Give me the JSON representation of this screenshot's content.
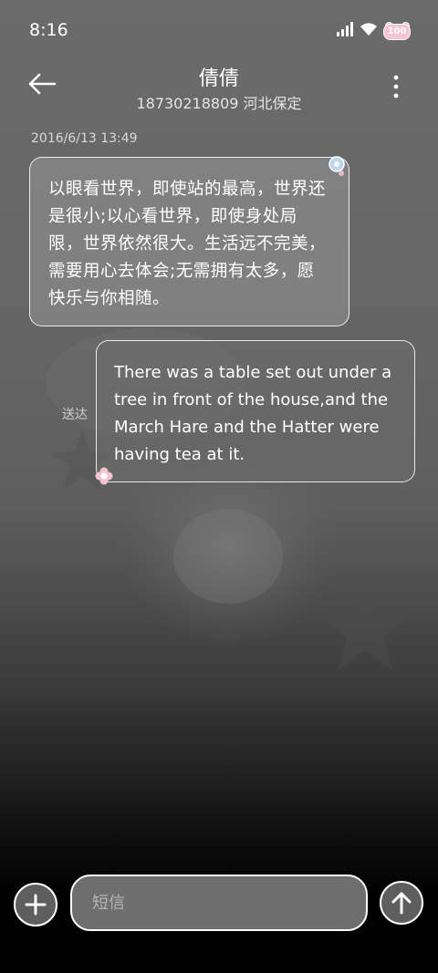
{
  "status_bar": {
    "time": "8:16",
    "battery_level": "100",
    "icons": [
      "signal-icon",
      "wifi-icon",
      "battery-icon"
    ]
  },
  "header": {
    "contact_name": "倩倩",
    "contact_subtitle": "18730218809 河北保定",
    "icons": [
      "back-arrow-icon",
      "more-vertical-icon"
    ]
  },
  "conversation": {
    "timestamp": "2016/6/13 13:49",
    "messages": [
      {
        "direction": "received",
        "text": "以眼看世界，即使站的最高，世界还是很小;以心看世界，即使身处局限，世界依然很大。生活远不完美，需要用心去体会;无需拥有太多，愿快乐与你相随。"
      },
      {
        "direction": "sent",
        "text": "There was a table set out under a tree in front of the house,and the March Hare and the Hatter were having tea at it.",
        "status": "送达"
      }
    ]
  },
  "composer": {
    "placeholder": "短信",
    "value": "",
    "icons": [
      "plus-icon",
      "send-arrow-icon"
    ]
  },
  "colors": {
    "background_top": "#6b6b6b",
    "background_bottom": "#000000",
    "bubble_border": "#ffffff",
    "battery_badge": "#f6c3d2"
  }
}
